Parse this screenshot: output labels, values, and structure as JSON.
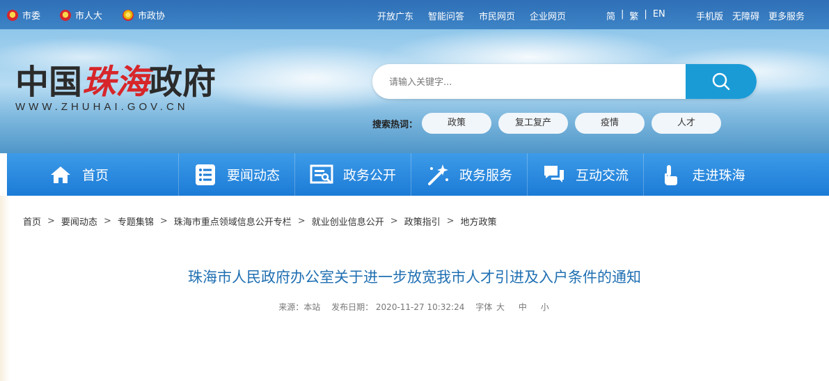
{
  "topbar": {
    "orgs": [
      "市委",
      "市人大",
      "市政协"
    ],
    "links": [
      "开放广东",
      "智能问答",
      "市民网页",
      "企业网页"
    ],
    "lang": [
      "简",
      "|",
      "繁",
      "|",
      "EN"
    ],
    "right": [
      "手机版",
      "无障碍",
      "更多服务"
    ]
  },
  "logo": {
    "cn_part1": "中国",
    "cn_part2": "珠海",
    "cn_part3": "政府",
    "en": "WWW.ZHUHAI.GOV.CN"
  },
  "search": {
    "placeholder": "请输入关键字..."
  },
  "hot": {
    "label": "搜索热词：",
    "tags": [
      "政策",
      "复工复产",
      "疫情",
      "人才"
    ]
  },
  "nav": [
    {
      "label": "首页",
      "icon": "home-icon"
    },
    {
      "label": "要闻动态",
      "icon": "news-list-icon"
    },
    {
      "label": "政务公开",
      "icon": "document-icon"
    },
    {
      "label": "政务服务",
      "icon": "magic-wand-icon"
    },
    {
      "label": "互动交流",
      "icon": "chat-icon"
    },
    {
      "label": "走进珠海",
      "icon": "hand-pointer-icon"
    }
  ],
  "breadcrumb": [
    "首页",
    "要闻动态",
    "专题集锦",
    "珠海市重点领域信息公开专栏",
    "就业创业信息公开",
    "政策指引",
    "地方政策"
  ],
  "breadcrumb_sep": ">",
  "article": {
    "title": "珠海市人民政府办公室关于进一步放宽我市人才引进及入户条件的通知",
    "source": "来源：本站",
    "date": "发布日期： 2020-11-27 10:32:24",
    "font_label": "字体",
    "font_large": "大",
    "font_medium": "中",
    "font_small": "小"
  },
  "colors": {
    "nav_blue": "#1c7bd6",
    "title_blue": "#1f6fb2",
    "search_button": "#1a9bd6",
    "logo_red": "#d7262a"
  }
}
